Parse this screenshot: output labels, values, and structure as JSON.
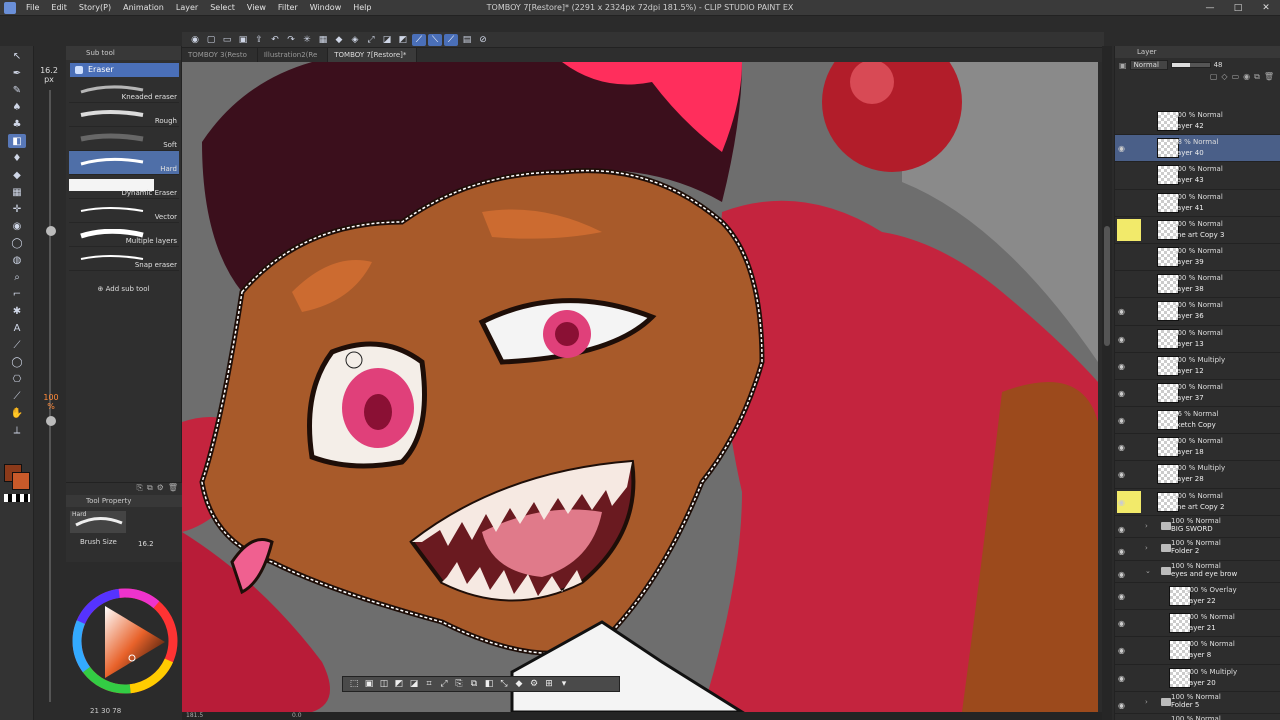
{
  "window": {
    "title": "TOMBOY 7[Restore]* (2291 x 2324px 72dpi 181.5%) - CLIP STUDIO PAINT EX",
    "controls": [
      "—",
      "□",
      "✕"
    ]
  },
  "menu": [
    "File",
    "Edit",
    "Story(P)",
    "Animation",
    "Layer",
    "Select",
    "View",
    "Filter",
    "Window",
    "Help"
  ],
  "tabs": [
    {
      "label": "TOMBOY 3(Resto",
      "active": false
    },
    {
      "label": "Illustration2(Re",
      "active": false
    },
    {
      "label": "TOMBOY 7[Restore]*",
      "active": true
    }
  ],
  "brush_size_indicator": {
    "value": "16.2",
    "unit": "px"
  },
  "opacity_badge": {
    "value": "100",
    "unit": "%"
  },
  "subtool": {
    "panel_title": "Sub tool",
    "group": "Eraser",
    "items": [
      {
        "label": "Kneaded eraser",
        "active": false
      },
      {
        "label": "Rough",
        "active": false
      },
      {
        "label": "Soft",
        "active": false
      },
      {
        "label": "Hard",
        "active": true
      },
      {
        "label": "Dynamic Eraser",
        "active": false
      },
      {
        "label": "Vector",
        "active": false
      },
      {
        "label": "Multiple layers",
        "active": false
      },
      {
        "label": "Snap eraser",
        "active": false
      }
    ],
    "add_label": "Add sub tool"
  },
  "tool_property": {
    "title": "Tool Property",
    "preview_label": "Hard",
    "brush_size_label": "Brush Size",
    "brush_size_value": "16.2"
  },
  "color_values": "21  30  78",
  "zoom": "181.5",
  "rotation": "0.0",
  "layer_panel": {
    "title": "Layer",
    "blend_mode": "Normal",
    "opacity": "48",
    "layers": [
      {
        "mode": "100 % Normal",
        "name": "Layer 42",
        "visible": false,
        "selected": false,
        "folder": false,
        "highlight": false
      },
      {
        "mode": "48 % Normal",
        "name": "Layer 40",
        "visible": true,
        "selected": true,
        "folder": false,
        "highlight": false
      },
      {
        "mode": "100 % Normal",
        "name": "Layer 43",
        "visible": false,
        "selected": false,
        "folder": false,
        "highlight": false
      },
      {
        "mode": "100 % Normal",
        "name": "Layer 41",
        "visible": false,
        "selected": false,
        "folder": false,
        "highlight": false
      },
      {
        "mode": "100 % Normal",
        "name": "line art Copy 3",
        "visible": false,
        "selected": false,
        "folder": false,
        "highlight": true
      },
      {
        "mode": "100 % Normal",
        "name": "Layer 39",
        "visible": false,
        "selected": false,
        "folder": false,
        "highlight": false
      },
      {
        "mode": "100 % Normal",
        "name": "Layer 38",
        "visible": false,
        "selected": false,
        "folder": false,
        "highlight": false
      },
      {
        "mode": "100 % Normal",
        "name": "Layer 36",
        "visible": true,
        "selected": false,
        "folder": false,
        "highlight": false
      },
      {
        "mode": "100 % Normal",
        "name": "Layer 13",
        "visible": true,
        "selected": false,
        "folder": false,
        "highlight": false
      },
      {
        "mode": "100 % Multiply",
        "name": "Layer 12",
        "visible": true,
        "selected": false,
        "folder": false,
        "highlight": false
      },
      {
        "mode": "100 % Normal",
        "name": "Layer 37",
        "visible": true,
        "selected": false,
        "folder": false,
        "highlight": false
      },
      {
        "mode": "56 % Normal",
        "name": "sketch Copy",
        "visible": true,
        "selected": false,
        "folder": false,
        "highlight": false
      },
      {
        "mode": "100 % Normal",
        "name": "Layer 18",
        "visible": true,
        "selected": false,
        "folder": false,
        "highlight": false
      },
      {
        "mode": "100 % Multiply",
        "name": "Layer 28",
        "visible": true,
        "selected": false,
        "folder": false,
        "highlight": false
      },
      {
        "mode": "100 % Normal",
        "name": "line art Copy 2",
        "visible": true,
        "selected": false,
        "folder": false,
        "highlight": true
      }
    ],
    "folders": [
      {
        "mode": "100 % Normal",
        "name": "BIG SWORD",
        "indent": false
      },
      {
        "mode": "100 % Normal",
        "name": "Folder 2",
        "indent": false
      },
      {
        "mode": "100 % Normal",
        "name": "eyes and eye brow",
        "indent": false
      }
    ],
    "sub_layers": [
      {
        "mode": "100 % Overlay",
        "name": "Layer 22"
      },
      {
        "mode": "100 % Normal",
        "name": "Layer 21"
      },
      {
        "mode": "100 % Normal",
        "name": "Layer 8"
      },
      {
        "mode": "100 % Multiply",
        "name": "Layer 20"
      }
    ],
    "tail_folder": {
      "mode": "100 % Normal",
      "name": "Folder 5"
    },
    "tail_layer": {
      "mode": "100 % Normal",
      "name": ""
    }
  }
}
